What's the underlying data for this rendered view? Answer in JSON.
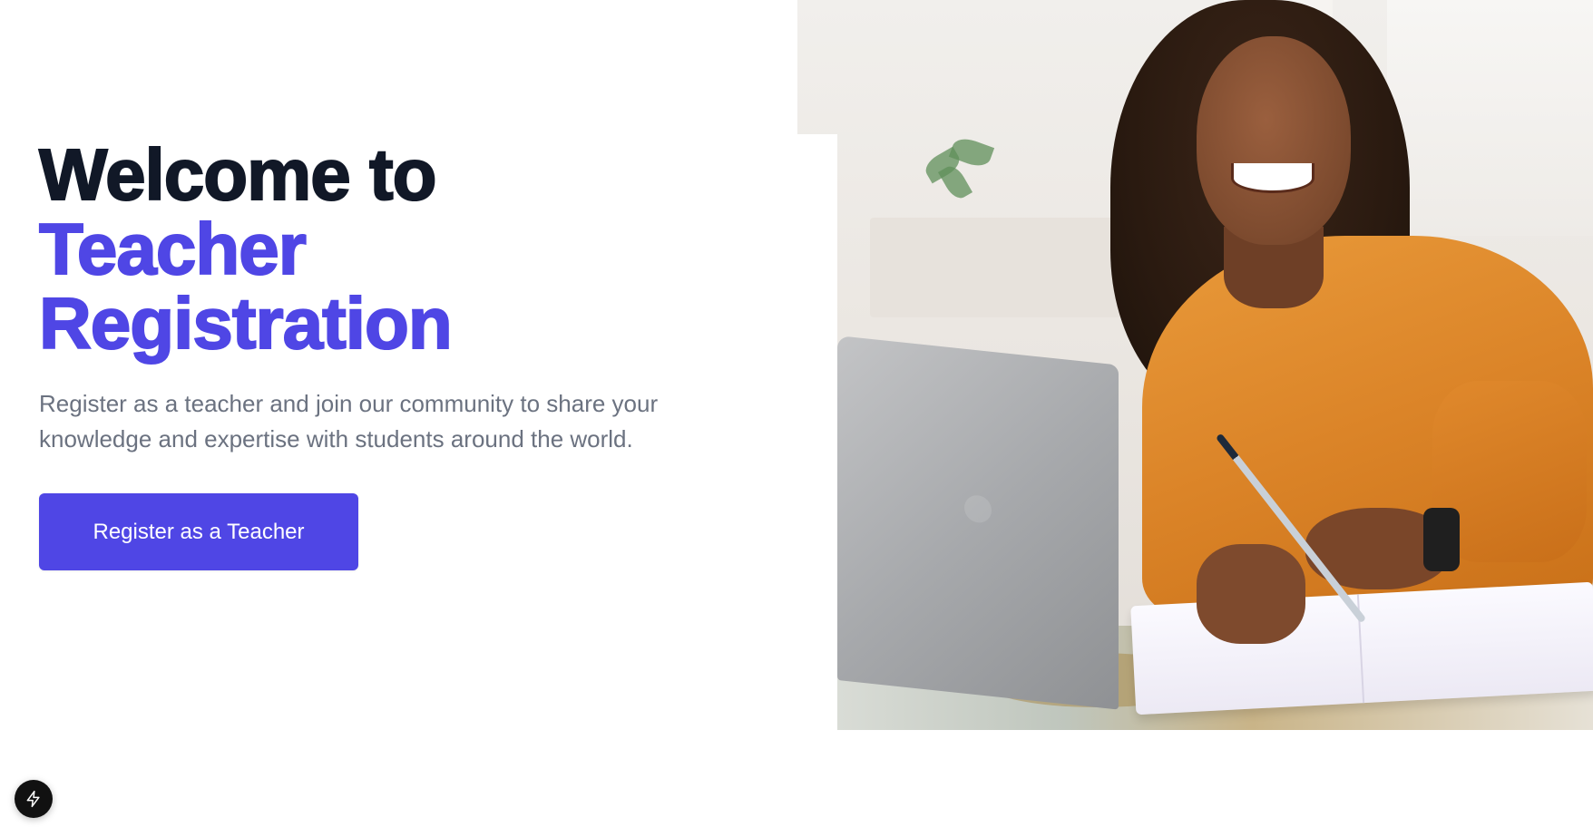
{
  "hero": {
    "headline_line_1": "Welcome to",
    "headline_accent_1": "Teacher",
    "headline_accent_2": "Registration",
    "subtitle": "Register as a teacher and join our community to share your knowledge and expertise with students around the world.",
    "cta_label": "Register as a Teacher"
  },
  "colors": {
    "heading": "#111827",
    "accent": "#4f46e5",
    "body_text": "#6b7280",
    "button_text": "#ffffff",
    "badge": "#111111"
  },
  "icons": {
    "dev_badge": "lightning-bolt-icon"
  }
}
